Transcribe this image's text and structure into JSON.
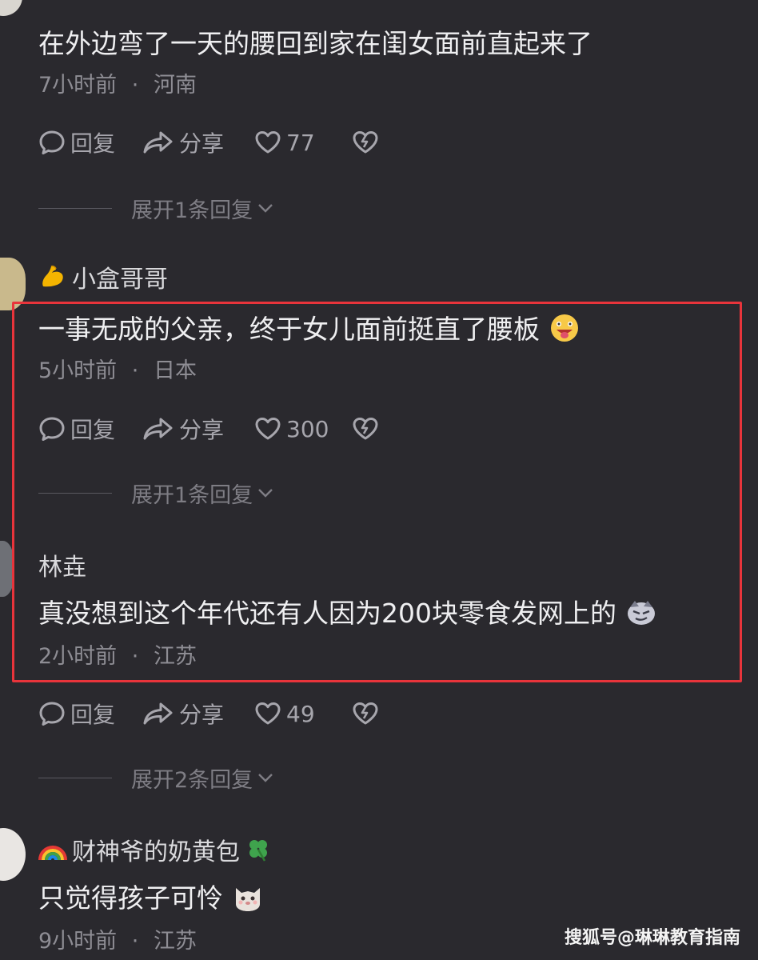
{
  "comments": [
    {
      "text": "在外边弯了一天的腰回到家在闺女面前直起来了",
      "time": "7小时前",
      "location": "河南",
      "likes": "77",
      "expand": "展开1条回复"
    },
    {
      "username": "小盒哥哥",
      "text": "一事无成的父亲，终于女儿面前挺直了腰板",
      "time": "5小时前",
      "location": "日本",
      "likes": "300",
      "expand": "展开1条回复"
    },
    {
      "username": "林垚",
      "text": "真没想到这个年代还有人因为200块零食发网上的",
      "time": "2小时前",
      "location": "江苏",
      "likes": "49",
      "expand": "展开2条回复"
    },
    {
      "username": "财神爷的奶黄包",
      "text": "只觉得孩子可怜",
      "time": "9小时前",
      "location": "江苏"
    }
  ],
  "actions": {
    "reply": "回复",
    "share": "分享"
  },
  "separator": "·",
  "watermark": "搜狐号@琳琳教育指南",
  "colors": {
    "background": "#2a292e",
    "highlight_border": "#e8343b",
    "text": "#efeff1",
    "meta": "#8e8d94"
  }
}
